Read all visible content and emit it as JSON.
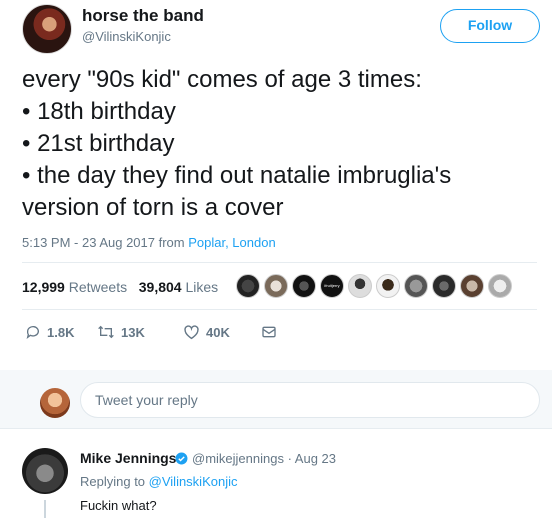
{
  "tweet": {
    "author_name": "horse the band",
    "author_handle": "@VilinskiKonjic",
    "follow_label": "Follow",
    "text_lines": [
      "every \"90s kid\" comes of age 3 times:",
      "• 18th birthday",
      "• 21st birthday",
      "• the day they find out natalie imbruglia's",
      "version of torn is a cover"
    ],
    "timestamp": "5:13 PM - 23 Aug 2017 from ",
    "location": "Poplar, London",
    "retweets_count": "12,999",
    "retweets_label": "Retweets",
    "likes_count": "39,804",
    "likes_label": "Likes",
    "liker_badge_text": "ifruitjerry",
    "actions": {
      "replies": "1.8K",
      "retweets": "13K",
      "likes": "40K"
    }
  },
  "reply_box": {
    "placeholder": "Tweet your reply"
  },
  "reply": {
    "author_name": "Mike Jennings",
    "handle_time": "@mikejjennings · Aug 23",
    "replying_prefix": "Replying to ",
    "replying_to": "@VilinskiKonjic",
    "text": "Fuckin what?"
  },
  "colors": {
    "accent": "#1da1f2",
    "secondary_text": "#657786",
    "divider": "#e6ecf0"
  }
}
